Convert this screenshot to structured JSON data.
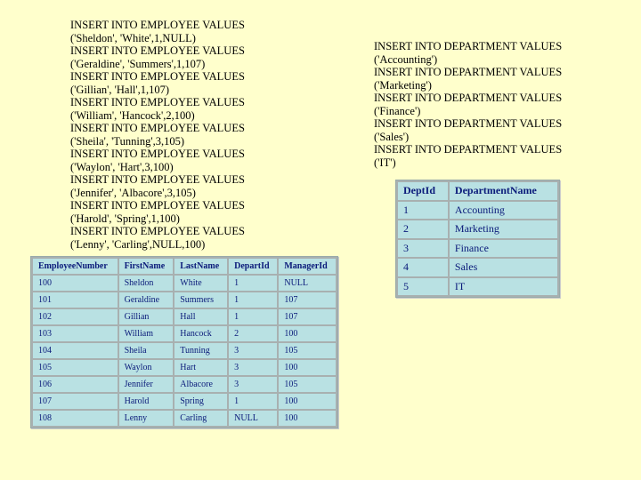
{
  "employee_sql": [
    "INSERT INTO EMPLOYEE VALUES",
    "('Sheldon', 'White',1,NULL)",
    "INSERT INTO EMPLOYEE VALUES",
    "('Geraldine', 'Summers',1,107)",
    "INSERT INTO EMPLOYEE VALUES",
    "('Gillian', 'Hall',1,107)",
    "INSERT INTO EMPLOYEE VALUES",
    "('William', 'Hancock',2,100)",
    "INSERT INTO EMPLOYEE VALUES",
    "('Sheila', 'Tunning',3,105)",
    "INSERT INTO EMPLOYEE VALUES",
    "('Waylon', 'Hart',3,100)",
    "INSERT INTO EMPLOYEE VALUES",
    "('Jennifer', 'Albacore',3,105)",
    "INSERT INTO EMPLOYEE VALUES",
    "('Harold', 'Spring',1,100)",
    "INSERT INTO EMPLOYEE VALUES",
    "('Lenny', 'Carling',NULL,100)"
  ],
  "department_sql": [
    "INSERT INTO DEPARTMENT VALUES",
    "('Accounting')",
    "INSERT INTO DEPARTMENT VALUES",
    "('Marketing')",
    "INSERT INTO DEPARTMENT VALUES",
    "('Finance')",
    "INSERT INTO DEPARTMENT VALUES",
    "('Sales')",
    "INSERT INTO DEPARTMENT VALUES",
    "('IT')"
  ],
  "employee_table": {
    "headers": [
      "EmployeeNumber",
      "FirstName",
      "LastName",
      "DepartId",
      "ManagerId"
    ],
    "rows": [
      [
        "100",
        "Sheldon",
        "White",
        "1",
        "NULL"
      ],
      [
        "101",
        "Geraldine",
        "Summers",
        "1",
        "107"
      ],
      [
        "102",
        "Gillian",
        "Hall",
        "1",
        "107"
      ],
      [
        "103",
        "William",
        "Hancock",
        "2",
        "100"
      ],
      [
        "104",
        "Sheila",
        "Tunning",
        "3",
        "105"
      ],
      [
        "105",
        "Waylon",
        "Hart",
        "3",
        "100"
      ],
      [
        "106",
        "Jennifer",
        "Albacore",
        "3",
        "105"
      ],
      [
        "107",
        "Harold",
        "Spring",
        "1",
        "100"
      ],
      [
        "108",
        "Lenny",
        "Carling",
        "NULL",
        "100"
      ]
    ]
  },
  "department_table": {
    "headers": [
      "DeptId",
      "DepartmentName"
    ],
    "rows": [
      [
        "1",
        "Accounting"
      ],
      [
        "2",
        "Marketing"
      ],
      [
        "3",
        "Finance"
      ],
      [
        "4",
        "Sales"
      ],
      [
        "5",
        "IT"
      ]
    ]
  },
  "colors": {
    "background": "#ffffcc",
    "table_cell": "#b9e1e3",
    "table_text": "#0a1a7a"
  }
}
